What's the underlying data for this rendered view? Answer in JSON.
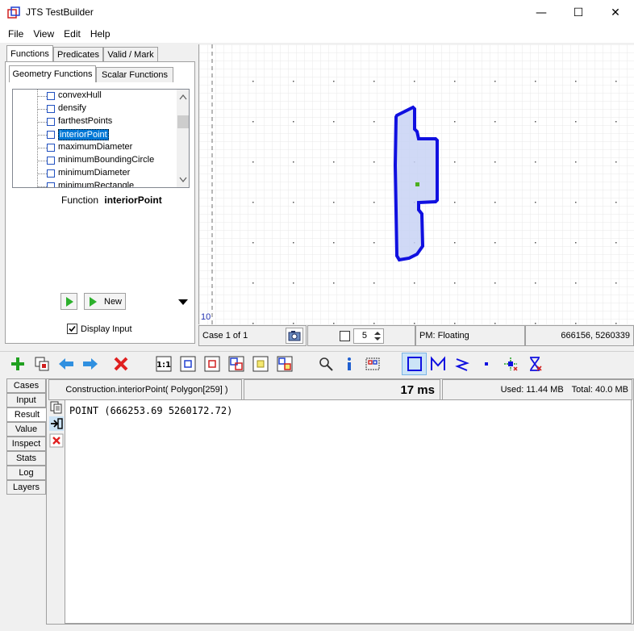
{
  "window": {
    "title": "JTS TestBuilder",
    "controls": {
      "minimize": "—",
      "maximize": "☐",
      "close": "✕"
    }
  },
  "menu": [
    "File",
    "View",
    "Edit",
    "Help"
  ],
  "left_panel": {
    "top_tabs": [
      "Functions",
      "Predicates",
      "Valid / Mark"
    ],
    "sub_tabs": [
      "Geometry Functions",
      "Scalar Functions"
    ],
    "functions": [
      "convexHull",
      "densify",
      "farthestPoints",
      "interiorPoint",
      "maximumDiameter",
      "minimumBoundingCircle",
      "minimumDiameter",
      "minimumRectangle"
    ],
    "selected_function": "interiorPoint",
    "function_label": "Function",
    "function_name": "interiorPoint",
    "new_button": "New",
    "display_input_label": "Display Input",
    "display_input_checked": true
  },
  "map": {
    "scale_label": "10"
  },
  "status_bar": {
    "case": "Case 1 of 1",
    "spinner_value": "5",
    "precision": "PM: Floating",
    "coordinates": "666156, 5260339"
  },
  "bottom": {
    "side_tabs": [
      "Cases",
      "Input",
      "Result",
      "Value",
      "Inspect",
      "Stats",
      "Log",
      "Layers"
    ],
    "active_side_tab": "Result",
    "expression": "Construction.interiorPoint( Polygon[259] )",
    "timing": "17 ms",
    "memory_used": "Used: 11.44 MB",
    "memory_total": "Total: 40.0 MB",
    "result": "POINT (666253.69 5260172.72)"
  },
  "colors": {
    "accent": "#0078d7",
    "geometry_stroke": "#1010e0",
    "geometry_fill": "#c8d2f5",
    "result_point": "#4caf20"
  }
}
